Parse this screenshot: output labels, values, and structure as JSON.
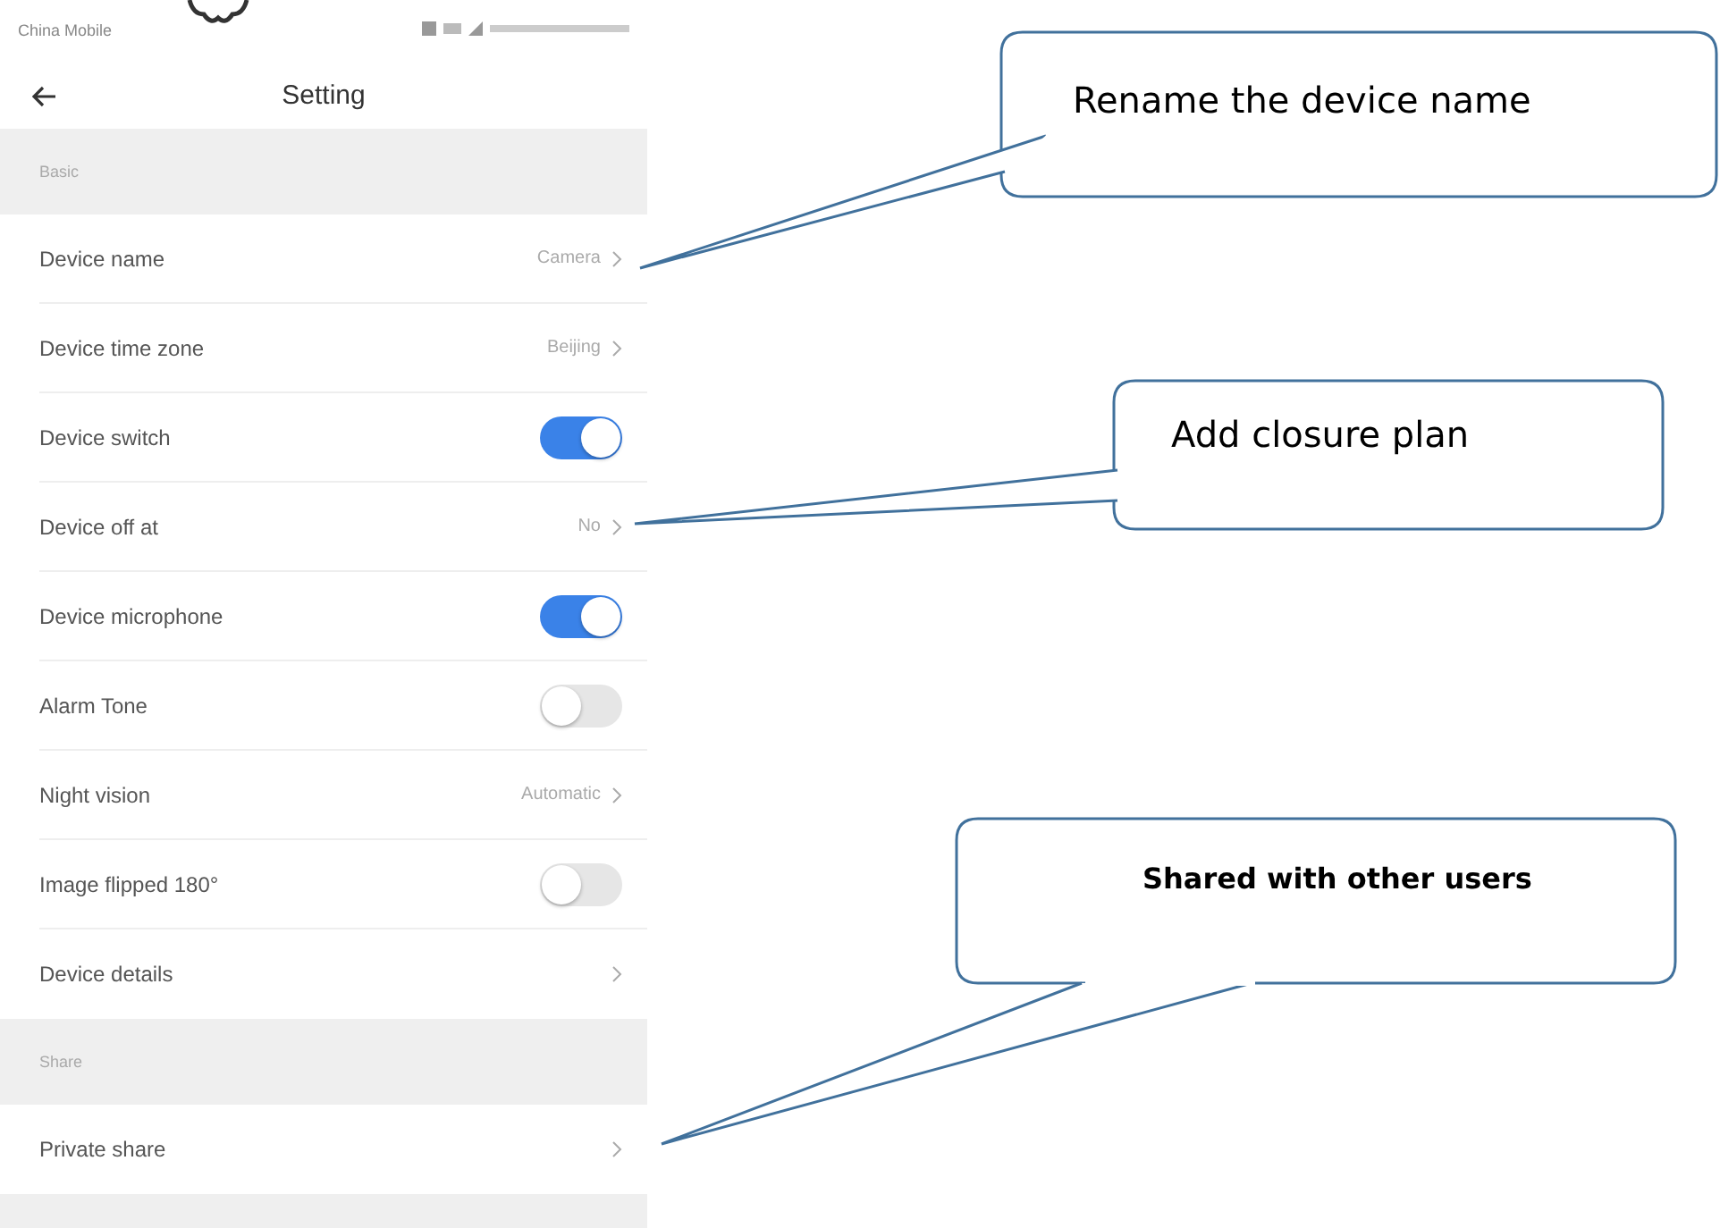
{
  "status_bar": {
    "carrier": "China Mobile"
  },
  "header": {
    "title": "Setting"
  },
  "sections": [
    {
      "title": "Basic",
      "rows": [
        {
          "kind": "link",
          "label": "Device name",
          "value": "Camera"
        },
        {
          "kind": "link",
          "label": "Device time zone",
          "value": "Beijing"
        },
        {
          "kind": "toggle",
          "label": "Device switch",
          "on": true
        },
        {
          "kind": "link",
          "label": "Device off at",
          "value": "No"
        },
        {
          "kind": "toggle",
          "label": "Device microphone",
          "on": true
        },
        {
          "kind": "toggle",
          "label": "Alarm Tone",
          "on": false
        },
        {
          "kind": "link",
          "label": "Night vision",
          "value": "Automatic"
        },
        {
          "kind": "toggle",
          "label": "Image flipped 180°",
          "on": false
        },
        {
          "kind": "link",
          "label": "Device details"
        }
      ]
    },
    {
      "title": "Share",
      "rows": [
        {
          "kind": "link",
          "label": "Private share"
        }
      ]
    }
  ],
  "callouts": [
    {
      "text": "Rename the device name",
      "bold": false
    },
    {
      "text": "Add closure plan",
      "bold": false
    },
    {
      "text": "Shared with other users",
      "bold": true
    }
  ]
}
